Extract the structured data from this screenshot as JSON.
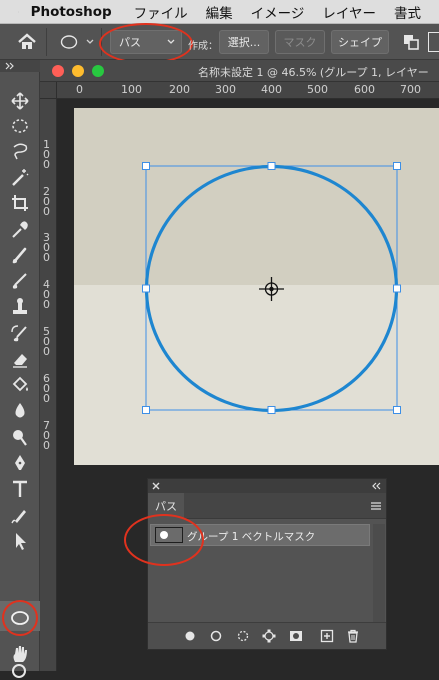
{
  "menubar": {
    "app_name": "Photoshop",
    "items": [
      "ファイル",
      "編集",
      "イメージ",
      "レイヤー",
      "書式"
    ]
  },
  "options": {
    "tool_mode_value": "パス",
    "make_label": "作成：",
    "select_button": "選択...",
    "mask_button": "マスク",
    "shape_button": "シェイプ"
  },
  "document": {
    "title": "名称未設定 1 @ 46.5% (グループ 1, レイヤー",
    "ruler_h": [
      "0",
      "100",
      "200",
      "300",
      "400",
      "500",
      "600",
      "700"
    ],
    "ruler_v": [
      "1 0 0",
      "2 0 0",
      "3 0 0",
      "4 0 0",
      "5 0 0",
      "6 0 0",
      "7 0 0"
    ]
  },
  "panel": {
    "tab_label": "パス",
    "path_name": "グループ 1 ベクトルマスク"
  },
  "colors": {
    "path_stroke": "#1e86d0",
    "selection_box": "#3d8fe6",
    "highlight_ring": "#e0321e"
  }
}
